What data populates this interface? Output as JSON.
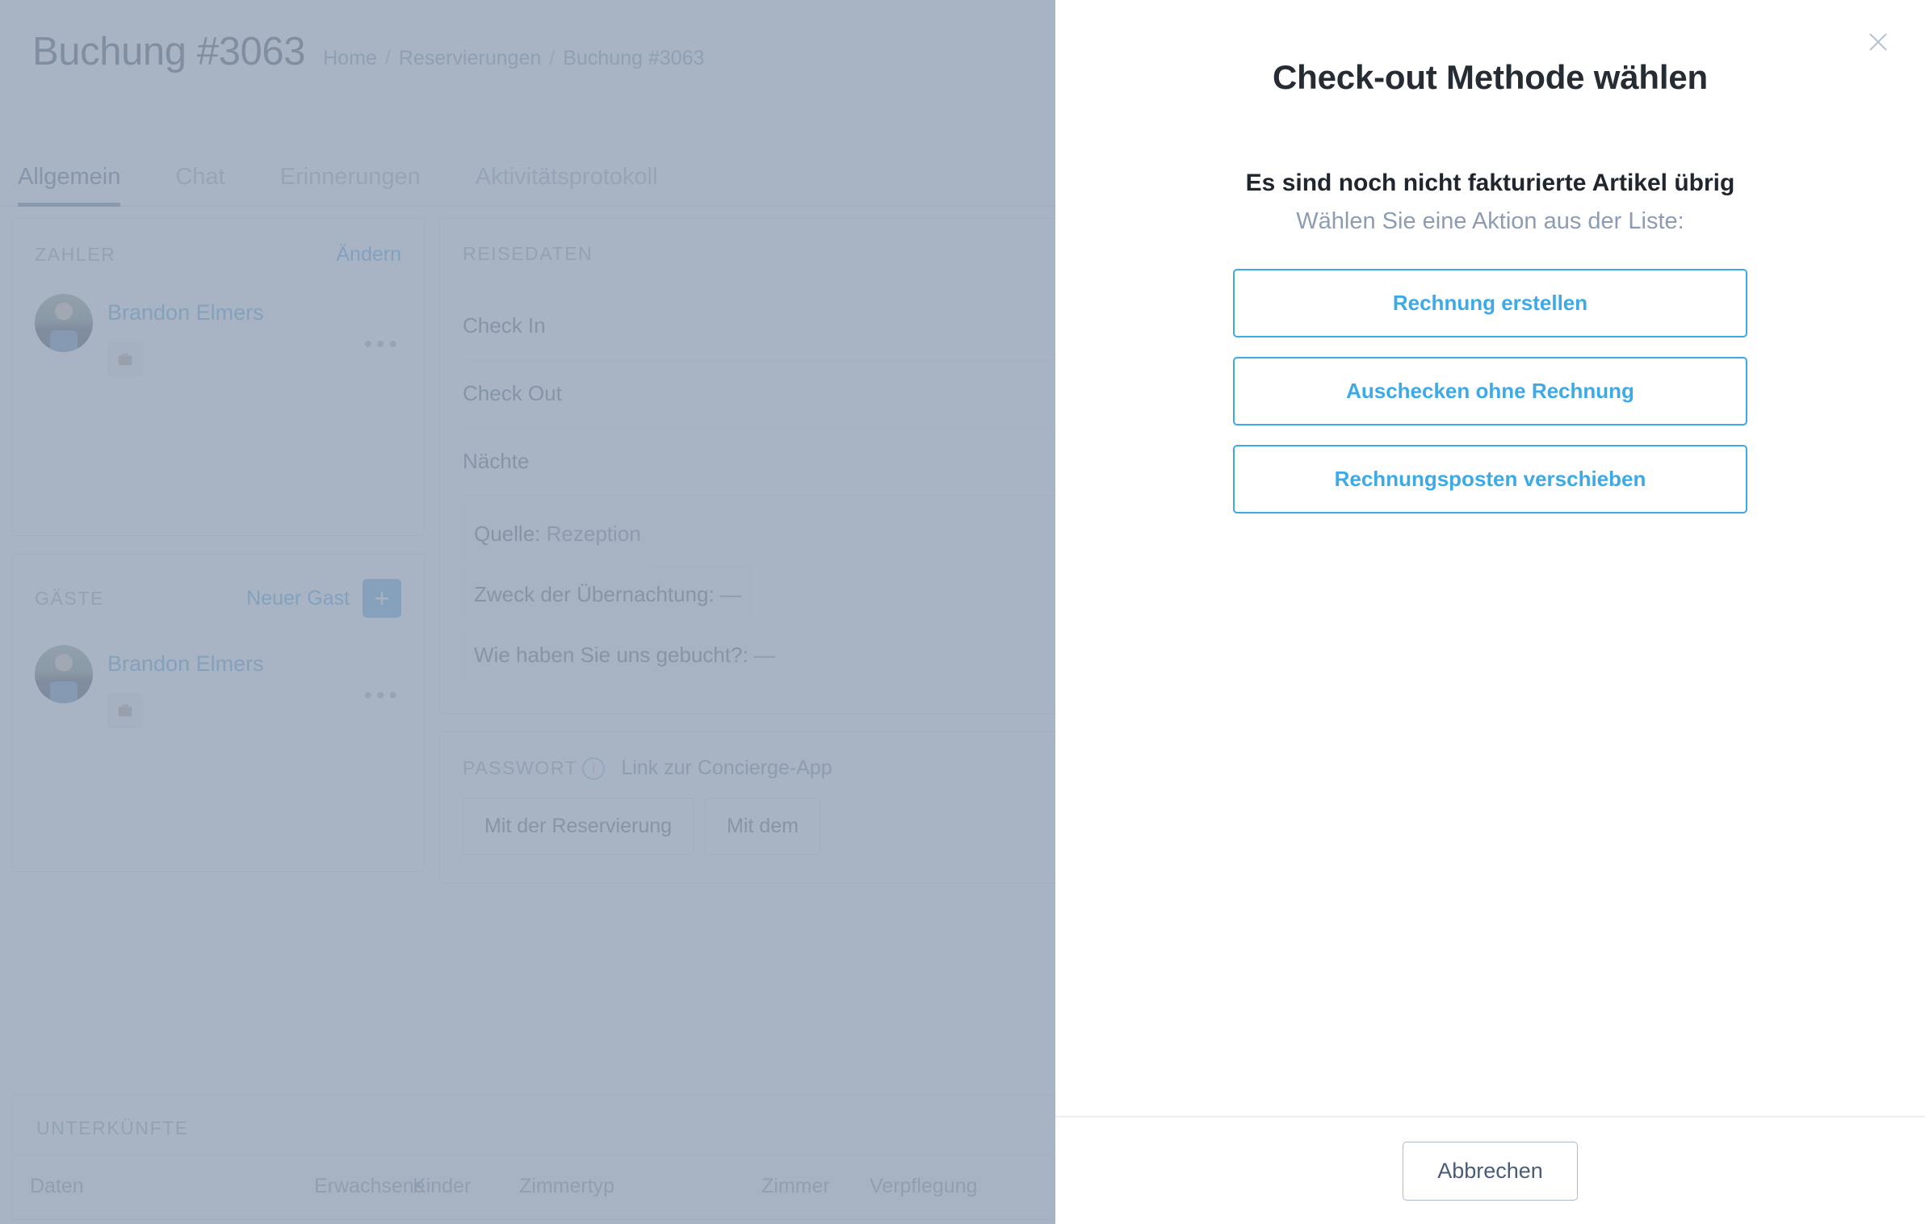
{
  "page": {
    "title": "Buchung #3063",
    "breadcrumb": [
      "Home",
      "Reservierungen",
      "Buchung #3063"
    ],
    "breadcrumb_separator": "/"
  },
  "tabs": [
    {
      "label": "Allgemein",
      "active": true
    },
    {
      "label": "Chat",
      "active": false
    },
    {
      "label": "Erinnerungen",
      "active": false
    },
    {
      "label": "Aktivitätsprotokoll",
      "active": false
    }
  ],
  "payer_card": {
    "section_label": "ZAHLER",
    "change_link": "Ändern",
    "person_name": "Brandon Elmers",
    "more_icon": "ellipsis-icon",
    "tag_icon": "briefcase-icon"
  },
  "guests_card": {
    "section_label": "GÄSTE",
    "new_guest_link": "Neuer Gast",
    "add_button_label": "+",
    "person_name": "Brandon Elmers",
    "more_icon": "ellipsis-icon",
    "tag_icon": "briefcase-icon"
  },
  "travel_card": {
    "section_label": "REISEDATEN",
    "rows": [
      {
        "label": "Check In",
        "value": ""
      },
      {
        "label": "Check Out",
        "value": ""
      },
      {
        "label": "Nächte",
        "value": ""
      }
    ],
    "pills": [
      {
        "key": "Quelle:",
        "value": "Rezeption"
      },
      {
        "key": "Zweck der Übernachtung:",
        "value": "—"
      },
      {
        "key": "Wie haben Sie uns gebucht?:",
        "value": "—"
      }
    ]
  },
  "password_card": {
    "section_label": "PASSWORT",
    "info_icon": "info-icon",
    "link_label": "Link zur Concierge-App",
    "buttons": [
      "Mit der Reservierung",
      "Mit dem"
    ]
  },
  "accommodation_card": {
    "section_label": "UNTERKÜNFTE",
    "columns": [
      "Daten",
      "Erwachsene",
      "Kinder",
      "Zimmertyp",
      "Zimmer",
      "Verpflegung"
    ]
  },
  "modal": {
    "close_icon": "close-icon",
    "title": "Check-out Methode wählen",
    "subtitle": "Es sind noch nicht fakturierte Artikel übrig",
    "hint": "Wählen Sie eine Aktion aus der Liste:",
    "choices": [
      "Rechnung erstellen",
      "Auschecken ohne Rechnung",
      "Rechnungsposten verschieben"
    ],
    "cancel_label": "Abbrechen"
  },
  "colors": {
    "accent_blue": "#3daae8",
    "link_blue": "#4aa3d9",
    "text_dark": "#3c4858",
    "text_muted": "#8d9aad",
    "overlay": "rgba(146,160,180,0.80)"
  }
}
